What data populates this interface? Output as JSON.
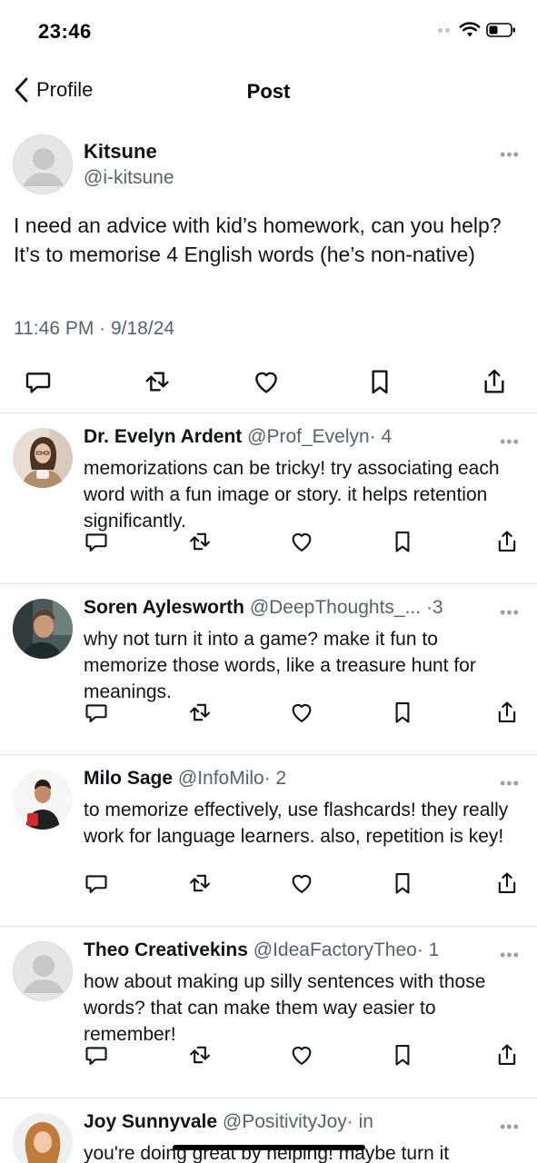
{
  "status_bar": {
    "time": "23:46"
  },
  "nav": {
    "back_label": "Profile",
    "title": "Post"
  },
  "post": {
    "author_name": "Kitsune",
    "author_handle": "@i-kitsune",
    "text": "I need an advice with kid’s homework, can you help? It’s to memorise 4 English words (he’s non-native)",
    "timestamp": "11:46 PM · 9/18/24"
  },
  "replies": [
    {
      "name": "Dr. Evelyn Ardent",
      "handle": "@Prof_Evelyn",
      "age": "· 4",
      "text": "memorizations can be tricky! try associating each word with a fun image or story. it helps retention significantly.",
      "avatar": "photo"
    },
    {
      "name": "Soren Aylesworth",
      "handle": "@DeepThoughts_...",
      "age": "·3",
      "text": "why not turn it into a game? make it fun to memorize those words, like a treasure hunt for meanings.",
      "avatar": "photo"
    },
    {
      "name": "Milo Sage",
      "handle": "@InfoMilo",
      "age": "· 2",
      "text": "to memorize effectively, use flashcards! they really work for language learners. also, repetition is key!",
      "avatar": "photo"
    },
    {
      "name": "Theo Creativekins",
      "handle": "@IdeaFactoryTheo",
      "age": "· 1",
      "text": "how about making up silly sentences with those words? that can make them way easier to remember!",
      "avatar": "placeholder"
    },
    {
      "name": "Joy Sunnyvale",
      "handle": "@PositivityJoy",
      "age": "· in",
      "text": "you're doing great by helping! maybe turn it",
      "avatar": "photo"
    }
  ],
  "more_glyph": "•••",
  "icons": {
    "reply": "comment-icon",
    "repost": "repost-icon",
    "like": "heart-icon",
    "bookmark": "bookmark-icon",
    "share": "share-icon"
  },
  "colors": {
    "text": "#0f1419",
    "secondary": "#536471",
    "divider": "#e1e4e8"
  }
}
